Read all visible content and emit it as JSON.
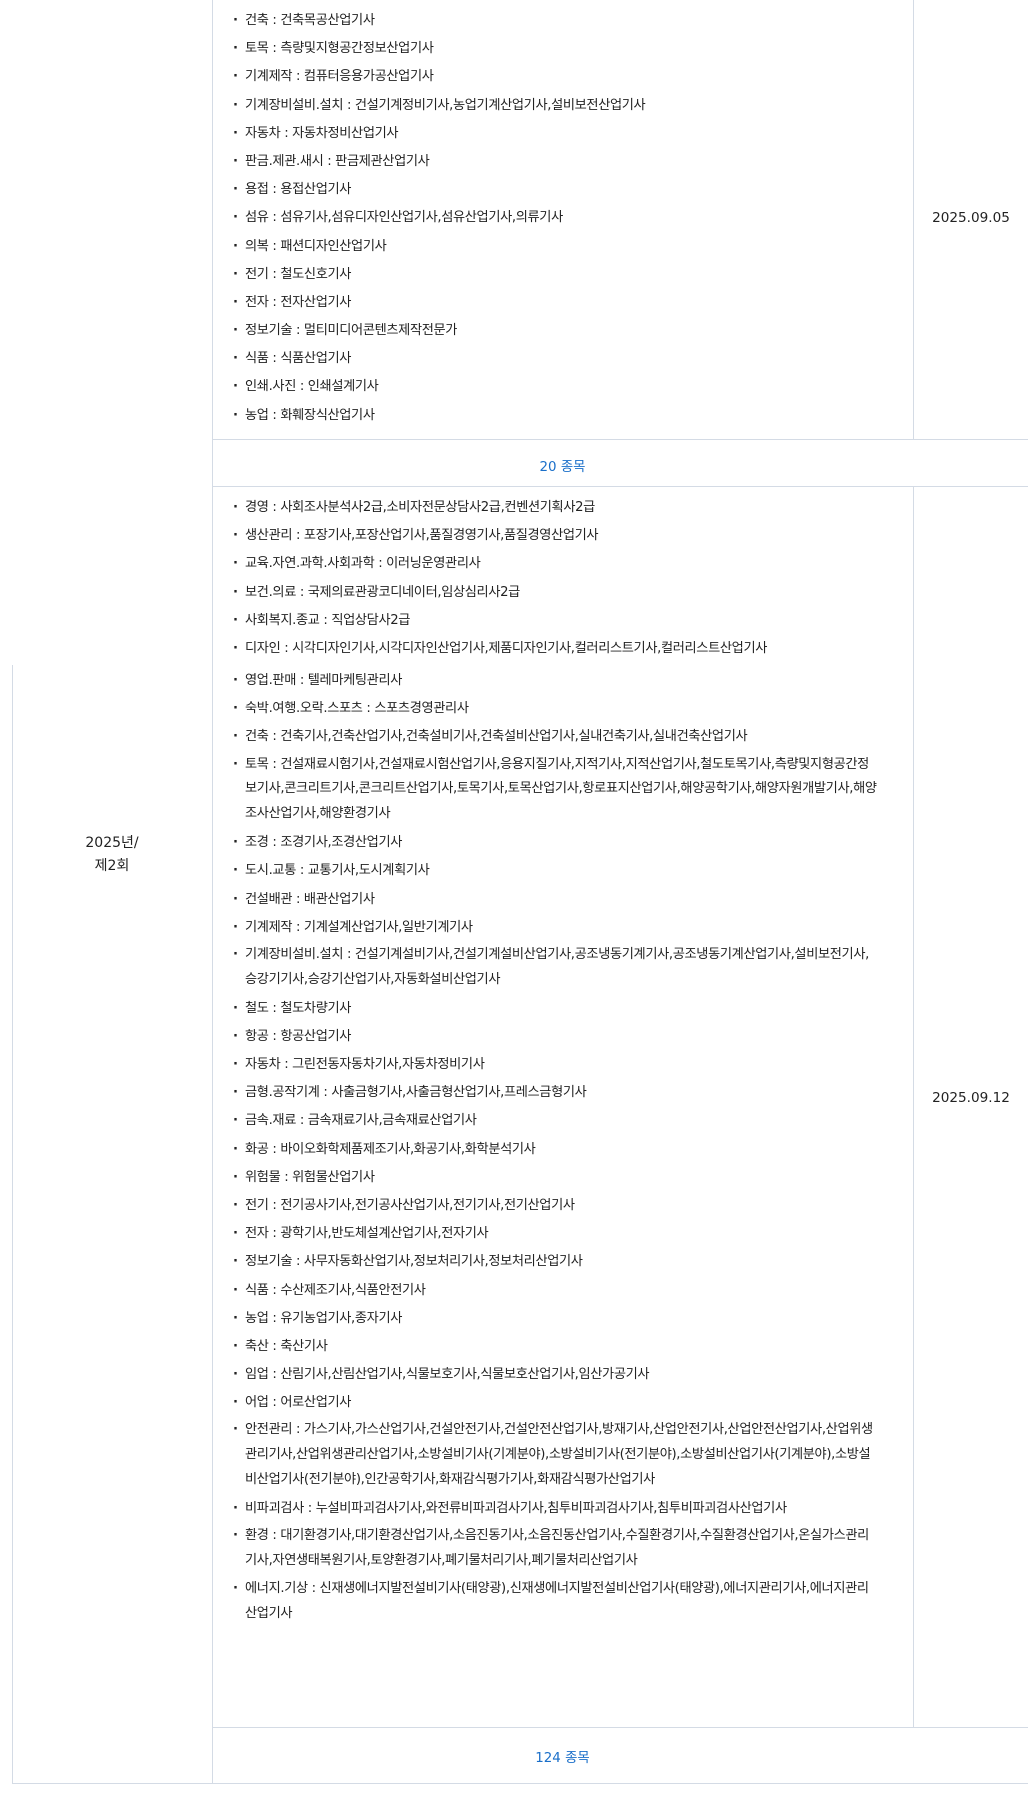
{
  "section_a": {
    "items": [
      "건축 : 건축목공산업기사",
      "토목 : 측량및지형공간정보산업기사",
      "기계제작 : 컴퓨터응용가공산업기사",
      "기계장비설비.설치 : 건설기계정비기사,농업기계산업기사,설비보전산업기사",
      "자동차 : 자동차정비산업기사",
      "판금.제관.새시 : 판금제관산업기사",
      "용접 : 용접산업기사",
      "섬유 : 섬유기사,섬유디자인산업기사,섬유산업기사,의류기사",
      "의복 : 패션디자인산업기사",
      "전기 : 철도신호기사",
      "전자 : 전자산업기사",
      "정보기술 : 멀티미디어콘텐츠제작전문가",
      "식품 : 식품산업기사",
      "인쇄.사진 : 인쇄설계기사",
      "농업 : 화훼장식산업기사"
    ],
    "date": "2025.09.05",
    "count": "20 종목"
  },
  "section_b": {
    "round": "2025년/\n제2회",
    "date": "2025.09.12",
    "count": "124 종목",
    "items_top": [
      "경영 : 사회조사분석사2급,소비자전문상담사2급,컨벤션기획사2급",
      "생산관리 : 포장기사,포장산업기사,품질경영기사,품질경영산업기사",
      "교육.자연.과학.사회과학 : 이러닝운영관리사",
      "보건.의료 : 국제의료관광코디네이터,임상심리사2급",
      "사회복지.종교 : 직업상담사2급",
      "디자인 : 시각디자인기사,시각디자인산업기사,제품디자인기사,컬러리스트기사,컬러리스트산업기사"
    ],
    "items_bottom": [
      "영업.판매 : 텔레마케팅관리사",
      "숙박.여행.오락.스포츠 : 스포츠경영관리사",
      "건축 : 건축기사,건축산업기사,건축설비기사,건축설비산업기사,실내건축기사,실내건축산업기사",
      "토목 : 건설재료시험기사,건설재료시험산업기사,응용지질기사,지적기사,지적산업기사,철도토목기사,측량및지형공간정보기사,콘크리트기사,콘크리트산업기사,토목기사,토목산업기사,항로표지산업기사,해양공학기사,해양자원개발기사,해양조사산업기사,해양환경기사",
      "조경 : 조경기사,조경산업기사",
      "도시.교통 : 교통기사,도시계획기사",
      "건설배관 : 배관산업기사",
      "기계제작 : 기계설계산업기사,일반기계기사",
      "기계장비설비.설치 : 건설기계설비기사,건설기계설비산업기사,공조냉동기계기사,공조냉동기계산업기사,설비보전기사,승강기기사,승강기산업기사,자동화설비산업기사",
      "철도 : 철도차량기사",
      "항공 : 항공산업기사",
      "자동차 : 그린전동자동차기사,자동차정비기사",
      "금형.공작기계 : 사출금형기사,사출금형산업기사,프레스금형기사",
      "금속.재료 : 금속재료기사,금속재료산업기사",
      "화공 : 바이오화학제품제조기사,화공기사,화학분석기사",
      "위험물 : 위험물산업기사",
      "전기 : 전기공사기사,전기공사산업기사,전기기사,전기산업기사",
      "전자 : 광학기사,반도체설계산업기사,전자기사",
      "정보기술 : 사무자동화산업기사,정보처리기사,정보처리산업기사",
      "식품 : 수산제조기사,식품안전기사",
      "농업 : 유기농업기사,종자기사",
      "축산 : 축산기사",
      "임업 : 산림기사,산림산업기사,식물보호기사,식물보호산업기사,임산가공기사",
      "어업 : 어로산업기사",
      "안전관리 : 가스기사,가스산업기사,건설안전기사,건설안전산업기사,방재기사,산업안전기사,산업안전산업기사,산업위생관리기사,산업위생관리산업기사,소방설비기사(기계분야),소방설비기사(전기분야),소방설비산업기사(기계분야),소방설비산업기사(전기분야),인간공학기사,화재감식평가기사,화재감식평가산업기사",
      "비파괴검사 : 누설비파괴검사기사,와전류비파괴검사기사,침투비파괴검사기사,침투비파괴검사산업기사",
      "환경 : 대기환경기사,대기환경산업기사,소음진동기사,소음진동산업기사,수질환경기사,수질환경산업기사,온실가스관리기사,자연생태복원기사,토양환경기사,폐기물처리기사,폐기물처리산업기사",
      "에너지.기상 : 신재생에너지발전설비기사(태양광),신재생에너지발전설비산업기사(태양광),에너지관리기사,에너지관리산업기사"
    ]
  }
}
